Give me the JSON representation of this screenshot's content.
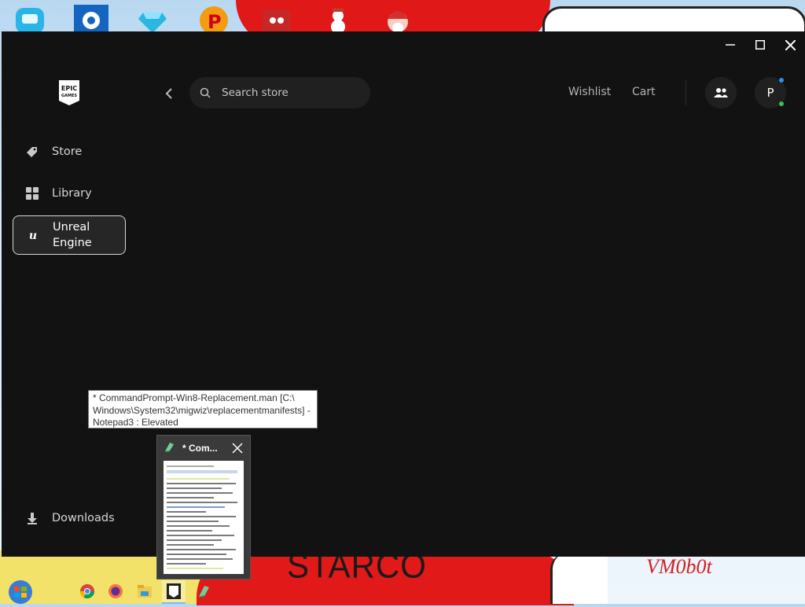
{
  "desktop": {
    "wallpaper_text": "STARCO",
    "wallpaper_signature": "VM0b0t",
    "icons": [
      "app-icon",
      "gear-icon",
      "gem-icon",
      "p-icon",
      "angry-bird-icon",
      "snowman-icon",
      "santa-icon"
    ]
  },
  "launcher": {
    "window_controls": {
      "minimize": "minimize-icon",
      "maximize": "maximize-icon",
      "close": "close-icon"
    },
    "logo": {
      "line1": "EPIC",
      "line2": "GAMES"
    },
    "search": {
      "placeholder": "Search store"
    },
    "header": {
      "wishlist": "Wishlist",
      "cart": "Cart",
      "avatar_initial": "P"
    },
    "sidebar": {
      "items": [
        {
          "label": "Store",
          "icon": "tag-icon"
        },
        {
          "label": "Library",
          "icon": "grid-icon"
        },
        {
          "label": "Unreal Engine",
          "line1": "Unreal",
          "line2": "Engine",
          "icon": "unreal-icon",
          "selected": true
        },
        {
          "label": "Downloads",
          "icon": "download-icon"
        }
      ]
    }
  },
  "tooltip": {
    "line1": "* CommandPrompt-Win8-Replacement.man [C:\\",
    "line2": "Windows\\System32\\migwiz\\replacementmanifests] -",
    "line3": "Notepad3 : Elevated"
  },
  "thumbnail": {
    "title": "* Com...",
    "icon": "notepad-icon"
  },
  "taskbar": {
    "apps": [
      "chrome-icon",
      "firefox-icon",
      "folder-icon",
      "epic-icon",
      "notepad-icon"
    ]
  },
  "colors": {
    "launcher_bg": "#121212",
    "search_bg": "#202020",
    "selected_border": "#d8d8d8",
    "wall_red": "#e01818"
  }
}
